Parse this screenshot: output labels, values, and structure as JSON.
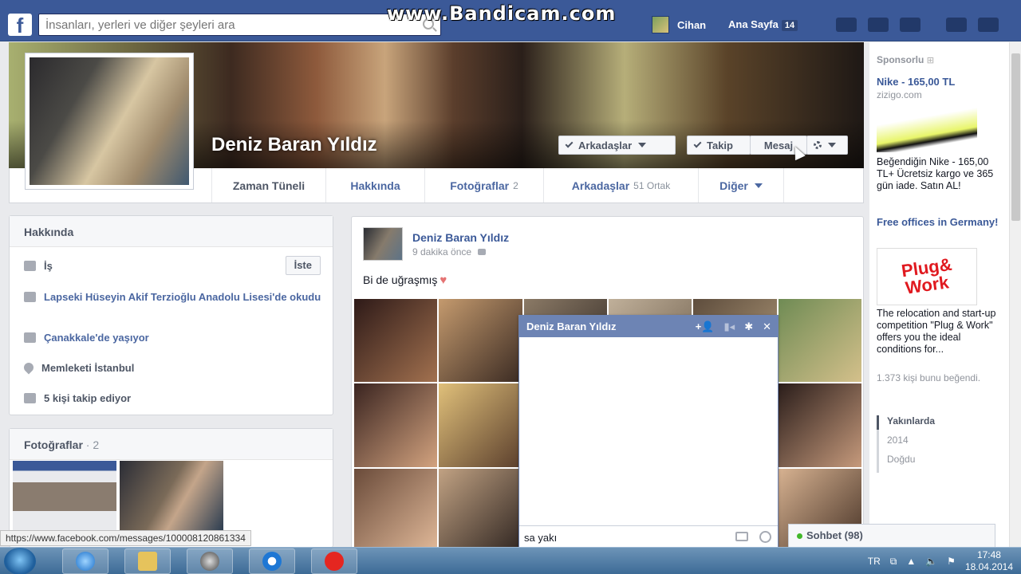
{
  "topbar": {
    "logo": "f",
    "search_placeholder": "İnsanları, yerleri ve diğer şeyleri ara",
    "watermark": "www.Bandicam.com",
    "user_name": "Cihan",
    "home_label": "Ana Sayfa",
    "home_count": "14"
  },
  "profile": {
    "name": "Deniz Baran Yıldız",
    "friends_button": "Arkadaşlar",
    "follow_button": "Takip",
    "message_button": "Mesaj"
  },
  "tabs": {
    "timeline": "Zaman Tüneli",
    "about": "Hakkında",
    "photos": "Fotoğraflar",
    "photos_count": "2",
    "friends": "Arkadaşlar",
    "friends_sub": "51 Ortak",
    "more": "Diğer"
  },
  "about_panel": {
    "title": "Hakkında",
    "work": "İş",
    "add_work_button": "İste",
    "school": "Lapseki Hüseyin Akif Terzioğlu Anadolu Lisesi'de okudu",
    "lives": "Çanakkale'de yaşıyor",
    "hometown": "Memleketi İstanbul",
    "followers": "5 kişi takip ediyor"
  },
  "photos_panel": {
    "title": "Fotoğraflar",
    "count": " · 2"
  },
  "post": {
    "author": "Deniz Baran Yıldız",
    "time": "9 dakika önce",
    "text": "Bi de uğraşmış"
  },
  "chat": {
    "title": "Deniz Baran Yıldız",
    "input_value": "sa yakı"
  },
  "right_col": {
    "sponsored": "Sponsorlu",
    "ad1_title": "Nike - 165,00 TL",
    "ad1_domain": "zizigo.com",
    "ad1_text": "Beğendiğin Nike - 165,00 TL+ Ücretsiz kargo ve 365 gün iade. Satın AL!",
    "ad2_title": "Free offices in Germany!",
    "ad2_logo_top": "Plug&",
    "ad2_logo_bottom": "Work",
    "ad2_text": "The relocation and start-up competition \"Plug & Work\" offers you the ideal conditions for...",
    "ad2_likes": "1.373 kişi bunu beğendi.",
    "timeline_recent": "Yakınlarda",
    "timeline_2014": "2014",
    "timeline_born": "Doğdu"
  },
  "chat_sidebar": {
    "label": "Sohbet (98)"
  },
  "status_url": "https://www.facebook.com/messages/100008120861334",
  "taskbar": {
    "lang": "TR",
    "time": "17:48",
    "date": "18.04.2014"
  }
}
